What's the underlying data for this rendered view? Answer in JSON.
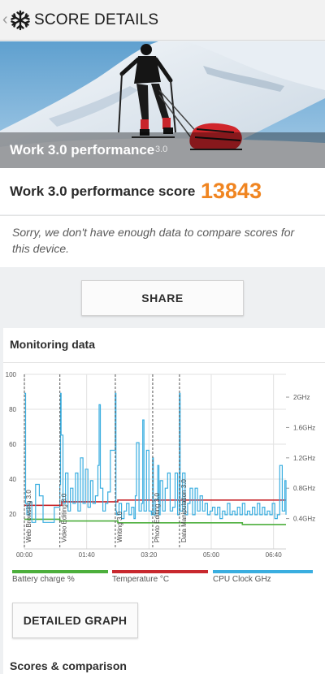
{
  "appbar": {
    "title": "SCORE DETAILS",
    "back_icon": "chevron-left-icon",
    "app_icon": "snowflake-icon"
  },
  "hero": {
    "title": "Work 3.0 performance",
    "version_label": "3.0"
  },
  "score": {
    "label": "Work 3.0 performance score",
    "value": "13843",
    "value_color": "#f08521"
  },
  "notice": {
    "text": "Sorry, we don't have enough data to compare scores for this device."
  },
  "share_button": {
    "label": "SHARE"
  },
  "monitoring": {
    "title": "Monitoring data",
    "legend": [
      {
        "label": "Battery charge %",
        "color": "#4caf3c"
      },
      {
        "label": "Temperature °C",
        "color": "#c8282e"
      },
      {
        "label": "CPU Clock GHz",
        "color": "#3aaee0"
      }
    ]
  },
  "detailed_graph_button": {
    "label": "DETAILED GRAPH"
  },
  "scores_section": {
    "title": "Scores & comparison"
  },
  "chart_data": {
    "type": "line",
    "x_ticks": [
      "00:00",
      "01:40",
      "03:20",
      "05:00",
      "06:40"
    ],
    "x_range_seconds": [
      0,
      420
    ],
    "y_left_ticks": [
      "100",
      "80",
      "60",
      "40",
      "20"
    ],
    "y_left_range": [
      0,
      100
    ],
    "y_right_ticks": [
      "2GHz",
      "1.6GHz",
      "1.2GHz",
      "0.8GHz",
      "0.4GHz"
    ],
    "y_right_range_ghz": [
      0,
      2.3
    ],
    "test_markers": [
      {
        "label": "Web Browsing 3.0",
        "t": 0
      },
      {
        "label": "Video Editing 3.0",
        "t": 57
      },
      {
        "label": "Writing 3.0",
        "t": 146
      },
      {
        "label": "Photo Editing 3.0",
        "t": 206
      },
      {
        "label": "Data Manipulation 3.0",
        "t": 249
      }
    ],
    "series": [
      {
        "name": "Battery charge %",
        "color": "#4caf3c",
        "t": [
          0,
          57,
          60,
          146,
          150,
          206,
          249,
          300,
          350,
          400,
          420
        ],
        "values": [
          17,
          16,
          16,
          16,
          15,
          15,
          15,
          15,
          14,
          14,
          14
        ]
      },
      {
        "name": "Temperature °C",
        "color": "#c8282e",
        "t": [
          0,
          57,
          60,
          146,
          150,
          206,
          249,
          300,
          350,
          400,
          420
        ],
        "values": [
          25,
          25,
          27,
          27,
          28,
          28,
          28,
          28,
          28,
          28,
          28
        ]
      },
      {
        "name": "CPU Clock GHz",
        "color": "#3aaee0",
        "t": [
          0,
          2,
          4,
          8,
          12,
          18,
          24,
          30,
          36,
          42,
          48,
          54,
          57,
          58,
          59,
          62,
          66,
          70,
          74,
          78,
          82,
          86,
          90,
          94,
          98,
          102,
          106,
          110,
          114,
          118,
          120,
          122,
          126,
          130,
          134,
          138,
          142,
          146,
          147,
          148,
          152,
          156,
          160,
          164,
          168,
          172,
          176,
          178,
          180,
          184,
          188,
          190,
          192,
          196,
          200,
          204,
          206,
          207,
          210,
          214,
          216,
          218,
          222,
          226,
          230,
          234,
          238,
          242,
          246,
          249,
          250,
          254,
          258,
          262,
          266,
          270,
          274,
          278,
          282,
          286,
          290,
          294,
          298,
          302,
          306,
          310,
          314,
          318,
          322,
          326,
          330,
          334,
          338,
          342,
          346,
          350,
          354,
          358,
          362,
          366,
          370,
          374,
          378,
          382,
          386,
          390,
          394,
          398,
          402,
          406,
          410,
          414,
          418,
          420
        ],
        "values": [
          2.05,
          0.6,
          0.45,
          0.62,
          0.35,
          0.85,
          0.7,
          0.35,
          0.35,
          0.35,
          0.55,
          0.55,
          0.85,
          2.05,
          1.5,
          0.6,
          1.0,
          0.5,
          0.8,
          0.6,
          1.0,
          0.5,
          1.2,
          0.6,
          1.05,
          0.55,
          0.9,
          0.6,
          0.7,
          1.1,
          1.9,
          0.8,
          0.5,
          0.6,
          0.75,
          1.3,
          1.3,
          2.05,
          0.5,
          0.45,
          0.6,
          0.4,
          0.5,
          0.6,
          0.45,
          0.55,
          0.4,
          0.7,
          1.4,
          0.5,
          0.6,
          1.7,
          0.5,
          1.3,
          0.5,
          0.45,
          1.2,
          0.45,
          0.65,
          1.1,
          0.45,
          0.9,
          0.5,
          0.8,
          1.0,
          0.5,
          0.55,
          1.0,
          0.45,
          2.05,
          0.5,
          1.0,
          0.45,
          0.6,
          0.8,
          0.45,
          0.8,
          0.5,
          0.7,
          0.5,
          0.6,
          0.45,
          0.5,
          0.55,
          0.45,
          0.55,
          0.4,
          0.5,
          0.45,
          0.6,
          0.45,
          0.5,
          0.45,
          0.55,
          0.45,
          0.6,
          0.45,
          0.5,
          0.45,
          0.55,
          0.45,
          0.6,
          0.45,
          0.55,
          0.45,
          0.5,
          0.45,
          0.6,
          0.4,
          0.45,
          1.1,
          0.5,
          0.9,
          0.45
        ]
      }
    ]
  }
}
